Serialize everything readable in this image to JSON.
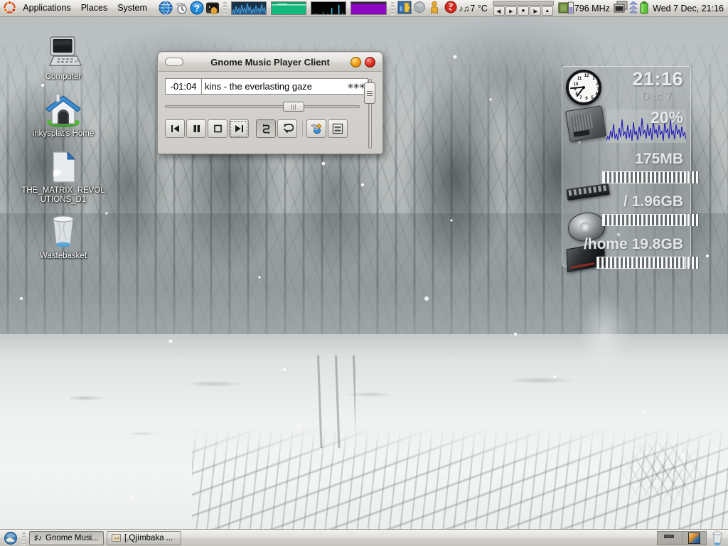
{
  "desktop": {
    "wallpaper_description": "snowy winter forest and field",
    "icons": [
      {
        "name": "computer",
        "label": "Computer",
        "icon": "computer-icon"
      },
      {
        "name": "home",
        "label": "inkysplat's Home",
        "icon": "home-folder-icon"
      },
      {
        "name": "dvd",
        "label": "THE_MATRIX_REVOLUTIONS_D1",
        "icon": "document-icon"
      },
      {
        "name": "wastebasket",
        "label": "Wastebasket",
        "icon": "trash-icon"
      }
    ]
  },
  "top_panel": {
    "logo": "ubuntu-logo-icon",
    "menus": [
      {
        "label": "Applications"
      },
      {
        "label": "Places"
      },
      {
        "label": "System"
      }
    ],
    "launchers": [
      {
        "name": "web-browser",
        "icon": "globe-icon"
      },
      {
        "name": "update-manager",
        "icon": "clock-update-icon"
      },
      {
        "name": "help",
        "icon": "question-mark-icon"
      },
      {
        "name": "terminal",
        "icon": "terminal-shell-icon"
      }
    ],
    "monitors": [
      {
        "name": "cpu-monitor",
        "color": "#18324a",
        "accent": "#4aa3e0"
      },
      {
        "name": "memory-monitor",
        "color": "#1b9c6b",
        "accent": "#9fe8c8"
      },
      {
        "name": "network-monitor",
        "color": "#050505",
        "accent": "#35c6e8"
      },
      {
        "name": "swap-monitor",
        "color": "#7a00a8",
        "accent": "#b13de0"
      }
    ],
    "tray": [
      {
        "name": "gdesklets",
        "icon": "puzzle-icon"
      },
      {
        "name": "globe-tray",
        "icon": "globe-small-icon"
      },
      {
        "name": "contact",
        "icon": "person-icon"
      }
    ],
    "weather": {
      "icon": "weather-icon",
      "note_icon": "music-note-icon",
      "temperature": "7 °C"
    },
    "media_controls": [
      {
        "name": "previous",
        "glyph": "◀|"
      },
      {
        "name": "play",
        "glyph": "▶"
      },
      {
        "name": "stop",
        "glyph": "■"
      },
      {
        "name": "next",
        "glyph": "|▶"
      },
      {
        "name": "eject",
        "glyph": "▲"
      }
    ],
    "cpu_freq": {
      "icon": "cpu-chip-icon",
      "value": "796 MHz"
    },
    "right_icons": [
      {
        "name": "workspace-switcher-tray",
        "icon": "windows-stack-icon"
      },
      {
        "name": "network",
        "icon": "blue-arrows-icon"
      },
      {
        "name": "battery",
        "icon": "battery-icon"
      }
    ],
    "clock": "Wed  7 Dec, 21:16"
  },
  "music_player": {
    "title": "Gnome Music Player Client",
    "window_buttons": [
      {
        "name": "minimize-pill",
        "color": "#ffffff"
      },
      {
        "name": "shade-button",
        "color": "#f4a017"
      },
      {
        "name": "close-button",
        "color": "#e03527"
      }
    ],
    "time": "-01:04",
    "track": "kins - the everlasting gaze",
    "rating": "✳✳✳",
    "seek_percent": 68,
    "volume_percent": 92,
    "buttons": [
      {
        "name": "previous-button",
        "glyph": "prev",
        "state": "normal"
      },
      {
        "name": "pause-button",
        "glyph": "pause",
        "state": "normal"
      },
      {
        "name": "stop-button",
        "glyph": "stop",
        "state": "normal"
      },
      {
        "name": "next-button",
        "glyph": "next",
        "state": "focused"
      },
      {
        "name": "shuffle-button",
        "glyph": "shuffle",
        "state": "active"
      },
      {
        "name": "repeat-button",
        "glyph": "repeat",
        "state": "normal"
      },
      {
        "name": "preferences-button",
        "glyph": "prefs",
        "state": "normal"
      },
      {
        "name": "playlist-button",
        "glyph": "playlist",
        "state": "normal"
      }
    ]
  },
  "desklet": {
    "clock_time": "21:16",
    "clock_date": "Dec 7",
    "cpu": {
      "label": "20%",
      "icon": "cpu-chip-icon"
    },
    "memory": {
      "label": "175MB",
      "icon": "ram-stick-icon",
      "fill_percent": 86
    },
    "root_disk": {
      "label": "/  1.96GB",
      "icon": "hard-disk-icon",
      "fill_percent": 86
    },
    "home_disk": {
      "label": "/home  19.8GB",
      "icon": "book-disk-icon",
      "fill_percent": 88
    }
  },
  "bottom_panel": {
    "show_desktop": {
      "name": "show-desktop-button",
      "icon": "show-desktop-icon"
    },
    "tasks": [
      {
        "label": "Gnome Musi...",
        "icon": "music-note-icon",
        "pressed": true
      },
      {
        "label": "[.Qjímbaka ...",
        "icon": "window-icon",
        "pressed": false
      }
    ],
    "workspaces": [
      {
        "name": "workspace-1",
        "active": false
      },
      {
        "name": "workspace-2",
        "active": true
      }
    ],
    "trash": {
      "name": "trash-applet",
      "icon": "trash-icon"
    }
  }
}
